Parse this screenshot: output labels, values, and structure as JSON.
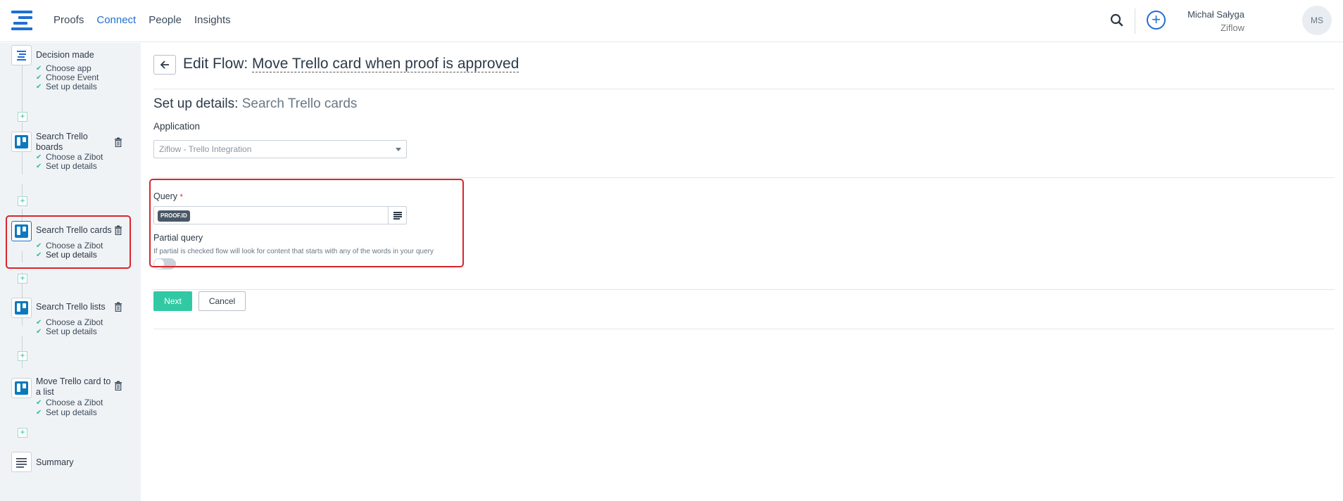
{
  "nav": {
    "items": [
      {
        "label": "Proofs",
        "active": false
      },
      {
        "label": "Connect",
        "active": true
      },
      {
        "label": "People",
        "active": false
      },
      {
        "label": "Insights",
        "active": false
      }
    ],
    "accent_color": "#1f6fd1"
  },
  "user": {
    "name": "Michał Sałyga",
    "org": "Ziflow",
    "initials": "MS"
  },
  "sidebar": {
    "steps": [
      {
        "title": "Decision made",
        "icon": "ziflow-icon",
        "subs": [
          "Choose app",
          "Choose Event",
          "Set up details"
        ]
      },
      {
        "title": "Search Trello boards",
        "icon": "trello-icon",
        "subs": [
          "Choose a Zibot",
          "Set up details"
        ]
      },
      {
        "title": "Search Trello cards",
        "icon": "trello-icon",
        "subs": [
          "Choose a Zibot",
          "Set up details"
        ],
        "selected": true
      },
      {
        "title": "Search Trello lists",
        "icon": "trello-icon",
        "subs": [
          "Choose a Zibot",
          "Set up details"
        ]
      },
      {
        "title": "Move Trello card to a list",
        "icon": "trello-icon",
        "subs": [
          "Choose a Zibot",
          "Set up details"
        ]
      },
      {
        "title": "Summary",
        "icon": "summary-icon",
        "subs": []
      }
    ]
  },
  "main": {
    "title_prefix": "Edit Flow:",
    "flow_name": "Move Trello card when proof is approved",
    "section_prefix": "Set up details:",
    "section_name": "Search Trello cards",
    "application_label": "Application",
    "application_value": "Ziflow - Trello Integration",
    "query_label": "Query",
    "query_required_mark": "*",
    "query_chip": "PROOF.ID",
    "partial_label": "Partial query",
    "partial_help": "If partial is checked flow will look for content that starts with any of the words in your query",
    "partial_enabled": false,
    "next_label": "Next",
    "cancel_label": "Cancel"
  }
}
